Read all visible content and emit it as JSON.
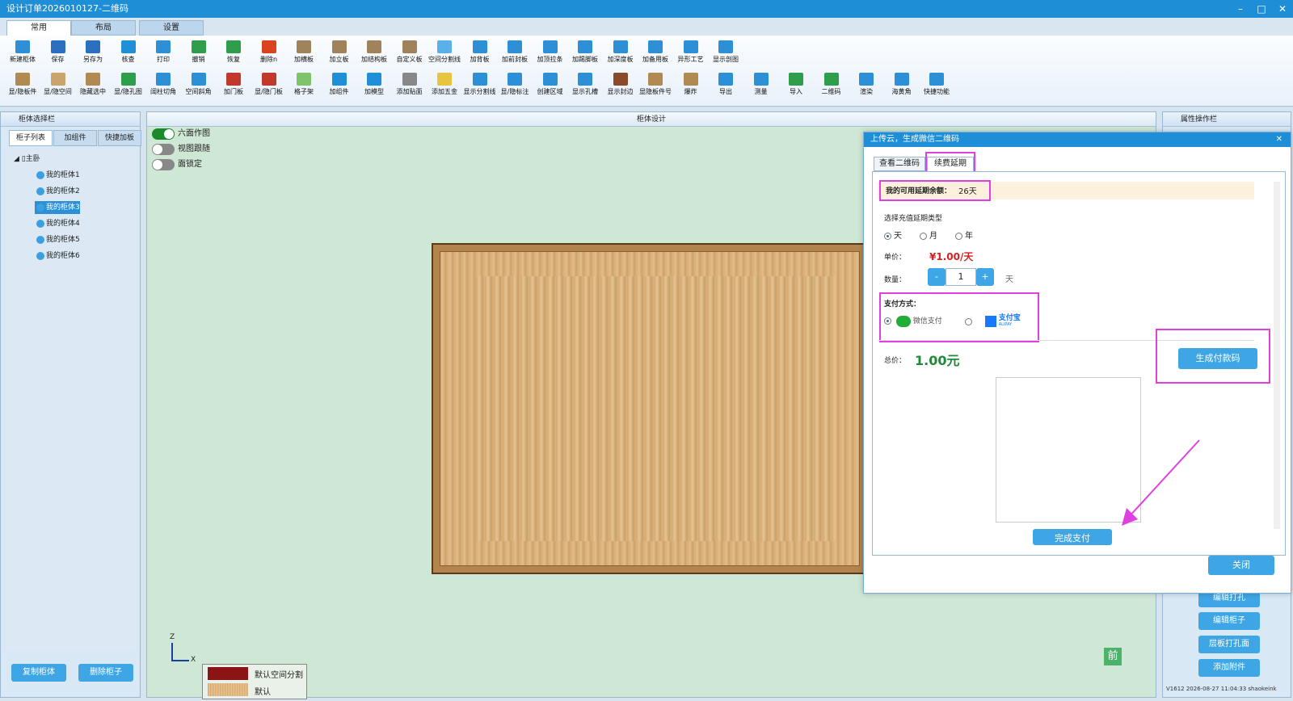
{
  "window": {
    "title": "设计订单2026010127-二维码",
    "min": "–",
    "max": "□",
    "close": "✕"
  },
  "main_tabs": [
    "常用",
    "布局",
    "设置"
  ],
  "toolbar_row1": [
    {
      "label": "新建柜体",
      "color": "#2d8fd6"
    },
    {
      "label": "保存",
      "color": "#2a6fc0"
    },
    {
      "label": "另存为",
      "color": "#2a6fc0"
    },
    {
      "label": "核查",
      "color": "#1f8fd8"
    },
    {
      "label": "打印",
      "color": "#2d8fd6"
    },
    {
      "label": "撤销",
      "color": "#2e9e4a"
    },
    {
      "label": "恢复",
      "color": "#2e9e4a"
    },
    {
      "label": "删除n",
      "color": "#d9431e"
    },
    {
      "label": "加横板",
      "color": "#a0835a"
    },
    {
      "label": "加立板",
      "color": "#a0835a"
    },
    {
      "label": "加结构板",
      "color": "#a0835a"
    },
    {
      "label": "自定义板",
      "color": "#a0835a"
    },
    {
      "label": "空间分割线",
      "color": "#5ab0e8"
    },
    {
      "label": "加背板",
      "color": "#2d8fd6"
    },
    {
      "label": "加前封板",
      "color": "#2d8fd6"
    },
    {
      "label": "加顶拉条",
      "color": "#2d8fd6"
    },
    {
      "label": "加踢脚板",
      "color": "#2d8fd6"
    },
    {
      "label": "加深度板",
      "color": "#2d8fd6"
    },
    {
      "label": "加备用板",
      "color": "#2d8fd6"
    },
    {
      "label": "异形工艺",
      "color": "#2d8fd6"
    },
    {
      "label": "显示剖图",
      "color": "#2d8fd6"
    }
  ],
  "toolbar_row2": [
    {
      "label": "显/隐板件",
      "color": "#b08a50"
    },
    {
      "label": "显/隐空间",
      "color": "#c9a46d"
    },
    {
      "label": "隐藏选中",
      "color": "#b08a50"
    },
    {
      "label": "显/隐孔图",
      "color": "#2e9e4a"
    },
    {
      "label": "阔柱切角",
      "color": "#2d8fd6"
    },
    {
      "label": "空间斜角",
      "color": "#2d8fd6"
    },
    {
      "label": "加门板",
      "color": "#c0392b"
    },
    {
      "label": "显/隐门板",
      "color": "#c0392b"
    },
    {
      "label": "格子架",
      "color": "#7fc36b"
    },
    {
      "label": "加组件",
      "color": "#1f8fd8"
    },
    {
      "label": "加模型",
      "color": "#1f8fd8"
    },
    {
      "label": "添加贴面",
      "color": "#888888"
    },
    {
      "label": "添加五金",
      "color": "#e8c440"
    },
    {
      "label": "显示分割线",
      "color": "#2d8fd6"
    },
    {
      "label": "显/隐标注",
      "color": "#2d8fd6"
    },
    {
      "label": "创建区域",
      "color": "#2d8fd6"
    },
    {
      "label": "显示孔槽",
      "color": "#2d8fd6"
    },
    {
      "label": "显示封边",
      "color": "#8b4b2a"
    },
    {
      "label": "显隐板件号",
      "color": "#b08a50"
    },
    {
      "label": "爆炸",
      "color": "#b08a50"
    },
    {
      "label": "导出",
      "color": "#2d8fd6"
    },
    {
      "label": "测量",
      "color": "#2d8fd6"
    },
    {
      "label": "导入",
      "color": "#2e9e4a"
    },
    {
      "label": "二维码",
      "color": "#2e9e4a"
    },
    {
      "label": "渲染",
      "color": "#2d8fd6"
    },
    {
      "label": "海黄角",
      "color": "#2d8fd6"
    },
    {
      "label": "快捷功能",
      "color": "#2d8fd6"
    }
  ],
  "left_panel": {
    "title": "柜体选择栏",
    "tabs": [
      "柜子列表",
      "加组件",
      "快捷加板"
    ],
    "root": "主卧",
    "items": [
      "我的柜体1",
      "我的柜体2",
      "我的柜体3",
      "我的柜体4",
      "我的柜体5",
      "我的柜体6"
    ],
    "selected_index": 2,
    "copy_button": "复制柜体",
    "delete_button": "删除柜子"
  },
  "center": {
    "title": "柜体设计",
    "toggles": [
      {
        "label": "六面作图",
        "on": true
      },
      {
        "label": "视图跟随",
        "on": false
      },
      {
        "label": "面锁定",
        "on": false
      }
    ],
    "axis_z": "Z",
    "axis_x": "X",
    "legend": [
      {
        "label": "默认空间分割",
        "color": "#8b1414"
      },
      {
        "label": "默认",
        "color": "#d9a86b"
      }
    ],
    "front_label": "前"
  },
  "right_panel": {
    "title": "属性操作栏",
    "buttons": [
      "编辑打孔",
      "编辑柜子",
      "层板打孔面",
      "添加附件"
    ],
    "footer": "V1612 2026-08-27 11:04:33 shaokeink"
  },
  "dialog": {
    "title": "上传云，生成微信二维码",
    "close": "✕",
    "tabs": [
      "查看二维码",
      "续费延期"
    ],
    "balance_label": "我的可用延期余额：",
    "balance_value": "26天",
    "type_label": "选择充值延期类型",
    "type_options": [
      "天",
      "月",
      "年"
    ],
    "price_label": "单价：",
    "price_value": "¥1.00/天",
    "qty_label": "数量：",
    "qty_minus": "-",
    "qty_value": "1",
    "qty_plus": "+",
    "qty_unit": "天",
    "pay_label": "支付方式：",
    "pay_wechat": "微信支付",
    "pay_alipay": "支付宝",
    "pay_alipay_sub": "ALIPAY",
    "total_label": "总价：",
    "total_value": "1.00元",
    "generate_button": "生成付款码",
    "done_button": "完成支付",
    "close_button": "关闭"
  }
}
